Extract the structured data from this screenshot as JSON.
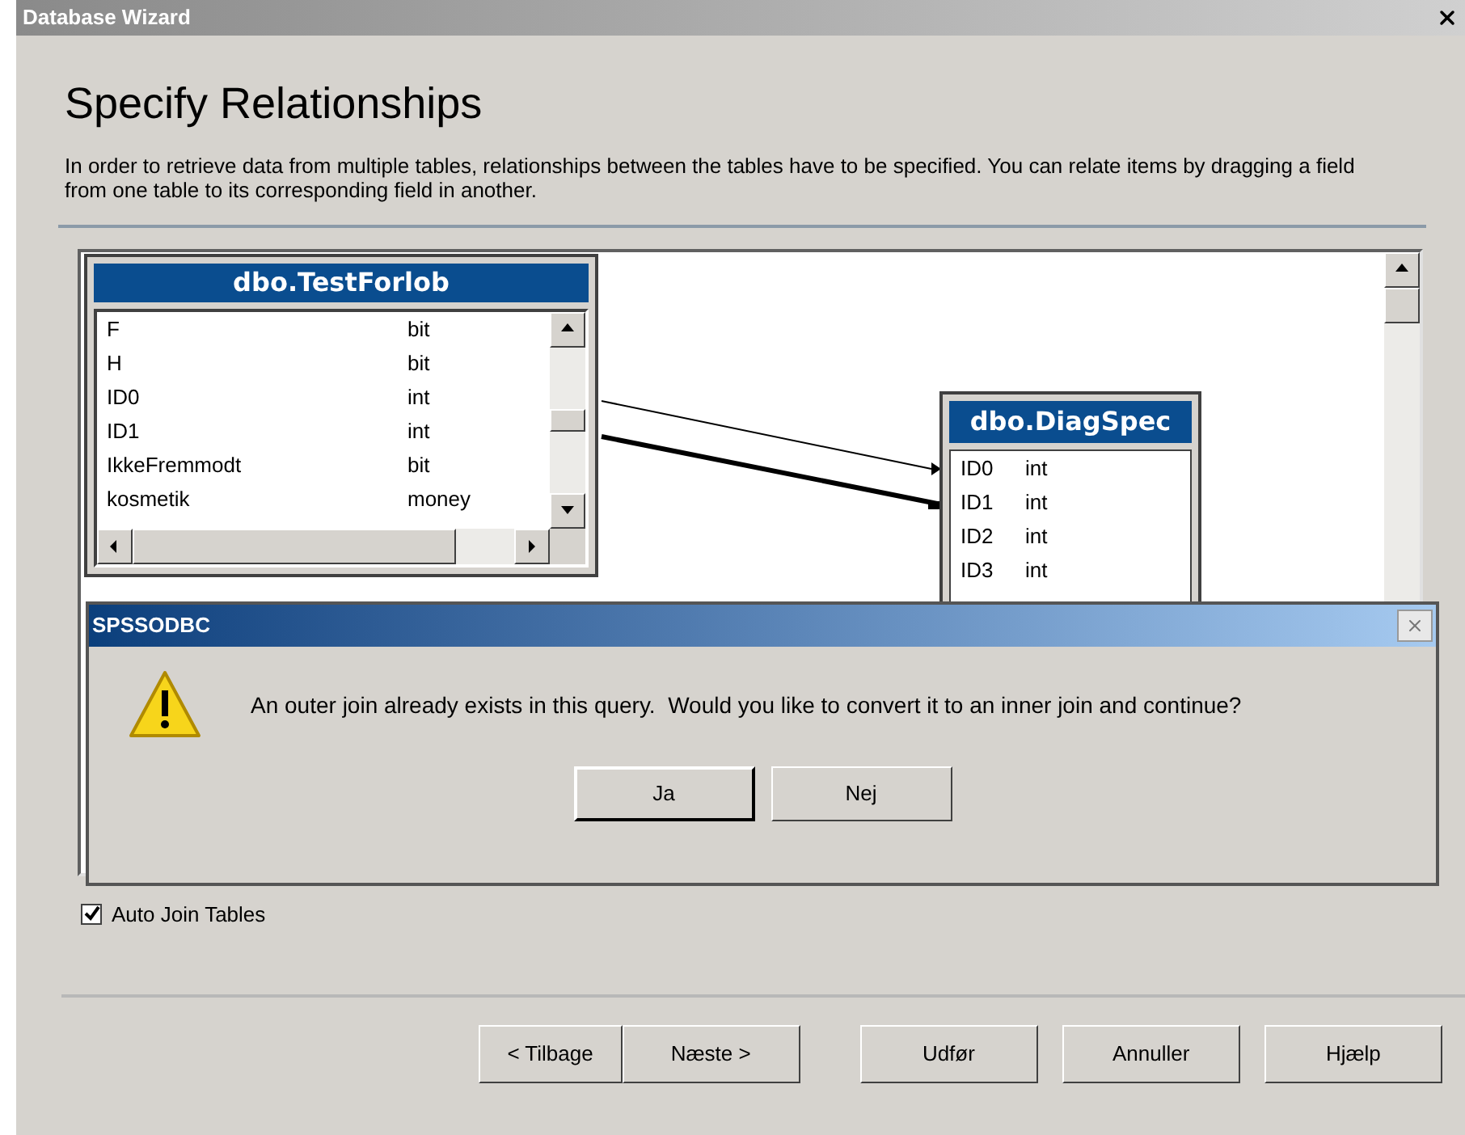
{
  "window": {
    "title": "Database Wizard"
  },
  "page": {
    "heading": "Specify Relationships",
    "description": "In order to retrieve data from multiple tables, relationships between the tables have to be specified. You can relate items by dragging a field from one table to its corresponding field in another."
  },
  "tables": [
    {
      "title": "dbo.TestForlob",
      "fields": [
        {
          "name": "F",
          "type": "bit"
        },
        {
          "name": "H",
          "type": "bit"
        },
        {
          "name": "ID0",
          "type": "int"
        },
        {
          "name": "ID1",
          "type": "int"
        },
        {
          "name": "IkkeFremmodt",
          "type": "bit"
        },
        {
          "name": "kosmetik",
          "type": "money"
        }
      ]
    },
    {
      "title": "dbo.DiagSpec",
      "fields": [
        {
          "name": "ID0",
          "type": "int"
        },
        {
          "name": "ID1",
          "type": "int"
        },
        {
          "name": "ID2",
          "type": "int"
        },
        {
          "name": "ID3",
          "type": "int"
        }
      ]
    }
  ],
  "joins": [
    {
      "kind": "outer"
    },
    {
      "kind": "inner"
    }
  ],
  "auto_join": {
    "label": "Auto Join Tables",
    "checked": true
  },
  "dialog": {
    "title": "SPSSODBC",
    "message": "An outer join already exists in this query.  Would you like to convert it to an inner join and continue?",
    "buttons": [
      {
        "label": "Ja",
        "default": true
      },
      {
        "label": "Nej",
        "default": false
      }
    ]
  },
  "buttons": [
    {
      "label": "< Tilbage"
    },
    {
      "label": "Næste >"
    },
    {
      "label": "Udfør"
    },
    {
      "label": "Annuller"
    },
    {
      "label": "Hjælp"
    }
  ]
}
